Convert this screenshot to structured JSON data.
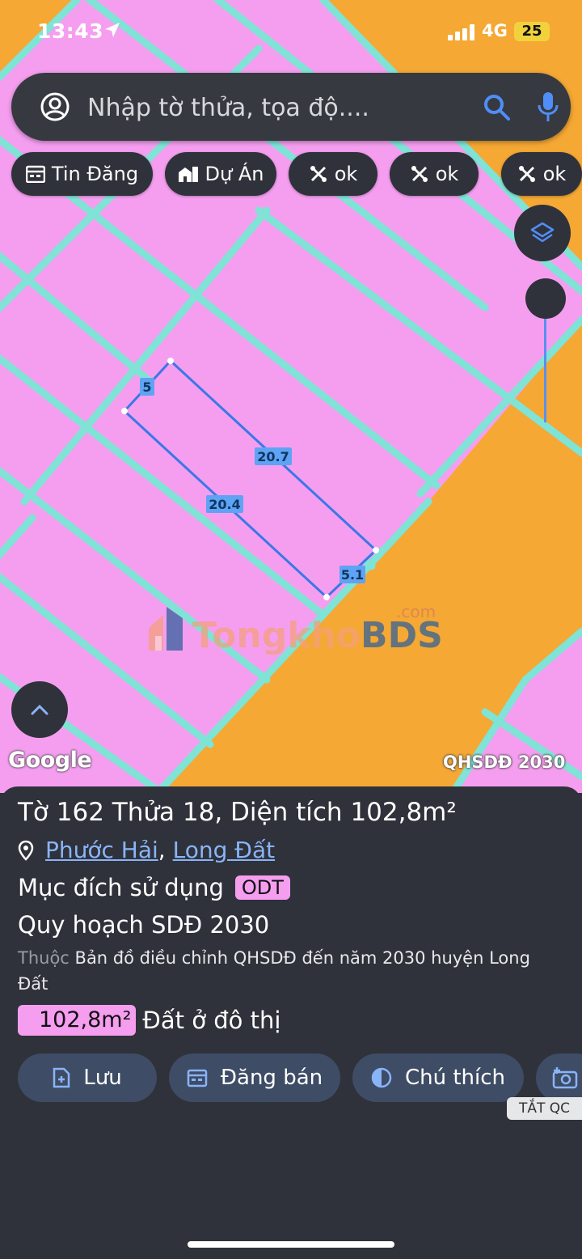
{
  "status_bar": {
    "time": "13:43",
    "network": "4G",
    "battery": "25"
  },
  "search": {
    "placeholder": "Nhập tờ thửa, tọa độ...."
  },
  "chips": [
    {
      "label": "Tin Đăng",
      "icon": "calendar-icon"
    },
    {
      "label": "Dự Án",
      "icon": "building-icon"
    },
    {
      "label": "ok",
      "icon": "tools-icon"
    },
    {
      "label": "ok",
      "icon": "tools-icon"
    },
    {
      "label": "ok",
      "icon": "tools-icon"
    }
  ],
  "map": {
    "dimension_labels": [
      "5",
      "20.7",
      "20.4",
      "5.1"
    ],
    "watermark": {
      "brand_a": "Tongkho",
      "brand_b": "BDS",
      "suffix": ".com"
    },
    "google_label": "Google",
    "layer_label": "QHSDĐ 2030",
    "colors": {
      "residential": "#f59ef0",
      "road": "#f5a834",
      "boundary": "#7fe3d6",
      "selection": "#3a78e6"
    }
  },
  "parcel": {
    "title_prefix": "Tờ",
    "sheet": "162",
    "plot_prefix": "Thửa",
    "plot": "18",
    "area_prefix": ", Diện tích",
    "area": "102,8m²",
    "ward": "Phước Hải",
    "district": "Long Đất",
    "purpose_label": "Mục đích sử dụng",
    "purpose_code": "ODT",
    "plan_label": "Quy hoạch SDĐ 2030",
    "source_prefix": "Thuộc",
    "source": "Bản đồ điều chỉnh QHSDĐ đến năm 2030 huyện Long Đất",
    "area_badge": "102,8m²",
    "land_type": "Đất ở đô thị"
  },
  "actions": [
    {
      "label": "Lưu",
      "icon": "file-add-icon"
    },
    {
      "label": "Đăng bán",
      "icon": "calendar-icon"
    },
    {
      "label": "Chú thích",
      "icon": "contrast-icon"
    }
  ],
  "ad_tag": "TẮT QC"
}
